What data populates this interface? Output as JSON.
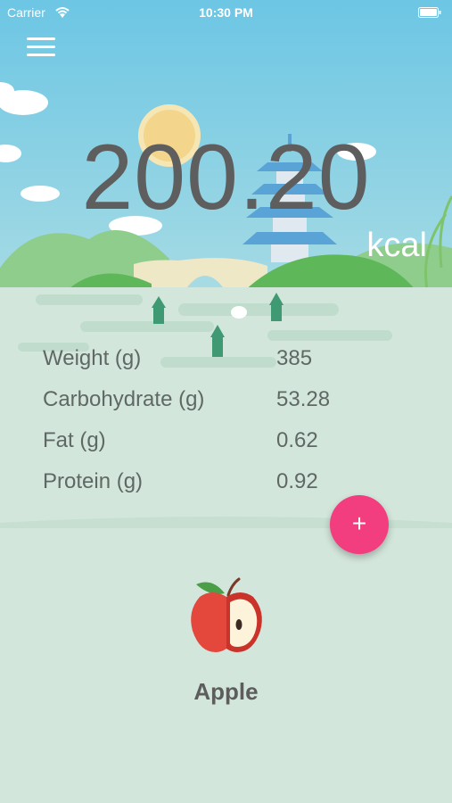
{
  "status_bar": {
    "carrier": "Carrier",
    "time": "10:30 PM"
  },
  "summary": {
    "calories": "200.20",
    "unit": "kcal"
  },
  "nutrients": [
    {
      "label": "Weight (g)",
      "value": "385"
    },
    {
      "label": "Carbohydrate (g)",
      "value": "53.28"
    },
    {
      "label": "Fat (g)",
      "value": "0.62"
    },
    {
      "label": "Protein (g)",
      "value": "0.92"
    }
  ],
  "fab": {
    "label": "+"
  },
  "food": {
    "name": "Apple",
    "icon": "apple-icon"
  },
  "colors": {
    "sky": "#7ecbe0",
    "lake": "#d3e6dc",
    "accent": "#f23e7e",
    "text": "#5f6864"
  }
}
